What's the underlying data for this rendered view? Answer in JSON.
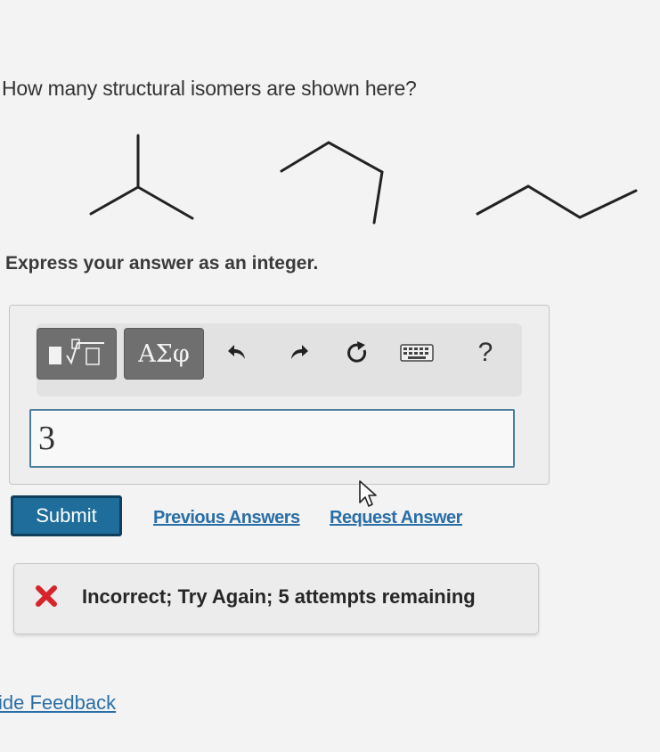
{
  "question": {
    "text": "How many structural isomers are shown here?"
  },
  "instruction": {
    "text": "Express your answer as an integer."
  },
  "toolbar": {
    "templates_icon": "templates-radical-icon",
    "symbols_label": "ΑΣφ",
    "undo_icon": "undo-icon",
    "redo_icon": "redo-icon",
    "reset_icon": "reset-icon",
    "keyboard_icon": "keyboard-icon",
    "help_label": "?"
  },
  "answer": {
    "value": "3"
  },
  "actions": {
    "submit_label": "Submit",
    "previous_answers_label": "Previous Answers",
    "request_answer_label": "Request Answer"
  },
  "feedback": {
    "status_icon": "x-mark-icon",
    "status_color": "#d6242a",
    "message": "Incorrect; Try Again; 5 attempts remaining"
  },
  "hide_feedback": {
    "label": "ide Feedback"
  },
  "colors": {
    "accent": "#1e6d9a",
    "link": "#2a6ea6"
  }
}
